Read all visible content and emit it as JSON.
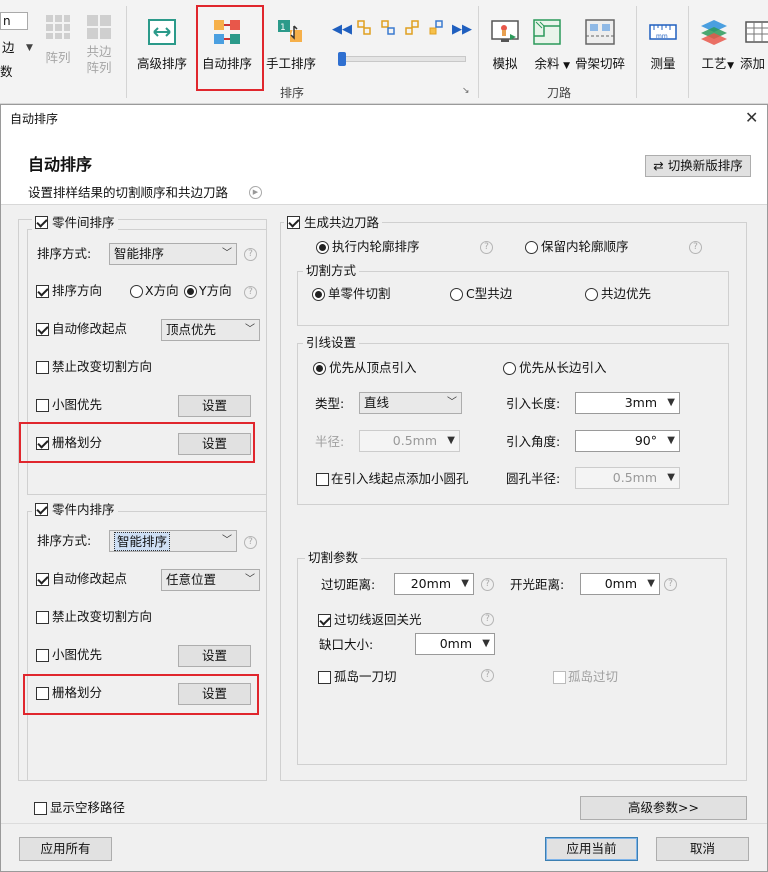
{
  "ribbon": {
    "left_partial_top": "n",
    "left_partial_mid": "边",
    "left_partial_bot": "数",
    "array_label": "阵列",
    "common_array_line1": "共边",
    "common_array_line2": "阵列",
    "advanced_sort": "高级排序",
    "auto_sort": "自动排序",
    "manual_sort": "手工排序",
    "sort_group": "排序",
    "simulate": "模拟",
    "remnant": "余料",
    "skeleton_cut": "骨架切碎",
    "toolpath_group": "刀路",
    "measure": "测量",
    "process": "工艺",
    "add_partial": "添加"
  },
  "dialog": {
    "window_title": "自动排序",
    "heading": "自动排序",
    "subtitle": "设置排样结果的切割顺序和共边刀路",
    "switch_button": "切换新版排序"
  },
  "left": {
    "between_parts": {
      "title": "零件间排序",
      "checked": true,
      "sort_method_label": "排序方式:",
      "sort_method_value": "智能排序",
      "sort_direction_label": "排序方向",
      "sort_direction_checked": true,
      "x_dir": "X方向",
      "y_dir": "Y方向",
      "selected_dir": "Y",
      "auto_start_label": "自动修改起点",
      "auto_start_checked": true,
      "auto_start_value": "顶点优先",
      "no_change_dir_label": "禁止改变切割方向",
      "no_change_dir_checked": false,
      "small_first_label": "小图优先",
      "small_first_checked": false,
      "settings_label": "设置",
      "grid_label": "栅格划分",
      "grid_checked": true
    },
    "within_parts": {
      "title": "零件内排序",
      "checked": true,
      "sort_method_label": "排序方式:",
      "sort_method_value": "智能排序",
      "auto_start_label": "自动修改起点",
      "auto_start_checked": true,
      "auto_start_value": "任意位置",
      "no_change_dir_label": "禁止改变切割方向",
      "no_change_dir_checked": false,
      "small_first_label": "小图优先",
      "small_first_checked": false,
      "settings_label": "设置",
      "grid_label": "栅格划分",
      "grid_checked": false
    },
    "show_travel_label": "显示空移路径",
    "show_travel_checked": false
  },
  "right": {
    "common_edge": {
      "title": "生成共边刀路",
      "checked": true,
      "exec_inner": "执行内轮廓排序",
      "keep_inner": "保留内轮廓顺序",
      "selected": "exec"
    },
    "cut_mode": {
      "title": "切割方式",
      "single": "单零件切割",
      "c_type": "C型共边",
      "common_first": "共边优先",
      "selected": "single"
    },
    "lead": {
      "title": "引线设置",
      "from_vertex": "优先从顶点引入",
      "from_long_edge": "优先从长边引入",
      "selected": "vertex",
      "type_label": "类型:",
      "type_value": "直线",
      "lead_length_label": "引入长度:",
      "lead_length_value": "3mm",
      "radius_label": "半径:",
      "radius_value": "0.5mm",
      "lead_angle_label": "引入角度:",
      "lead_angle_value": "90°",
      "add_hole_label": "在引入线起点添加小圆孔",
      "add_hole_checked": false,
      "hole_radius_label": "圆孔半径:",
      "hole_radius_value": "0.5mm"
    },
    "cut_params": {
      "title": "切割参数",
      "overcut_label": "过切距离:",
      "overcut_value": "20mm",
      "opening_label": "开光距离:",
      "opening_value": "0mm",
      "return_off_label": "过切线返回关光",
      "return_off_checked": true,
      "gap_label": "缺口大小:",
      "gap_value": "0mm",
      "island_one_label": "孤岛一刀切",
      "island_one_checked": false,
      "island_over_label": "孤岛过切",
      "island_over_checked": false
    },
    "advanced_button": "高级参数>>"
  },
  "footer": {
    "apply_all": "应用所有",
    "apply_current": "应用当前",
    "cancel": "取消"
  },
  "icons": {
    "help_glyph": "?"
  },
  "colors": {
    "highlight_red": "#e0262d",
    "primary_blue": "#3c7fb1"
  }
}
